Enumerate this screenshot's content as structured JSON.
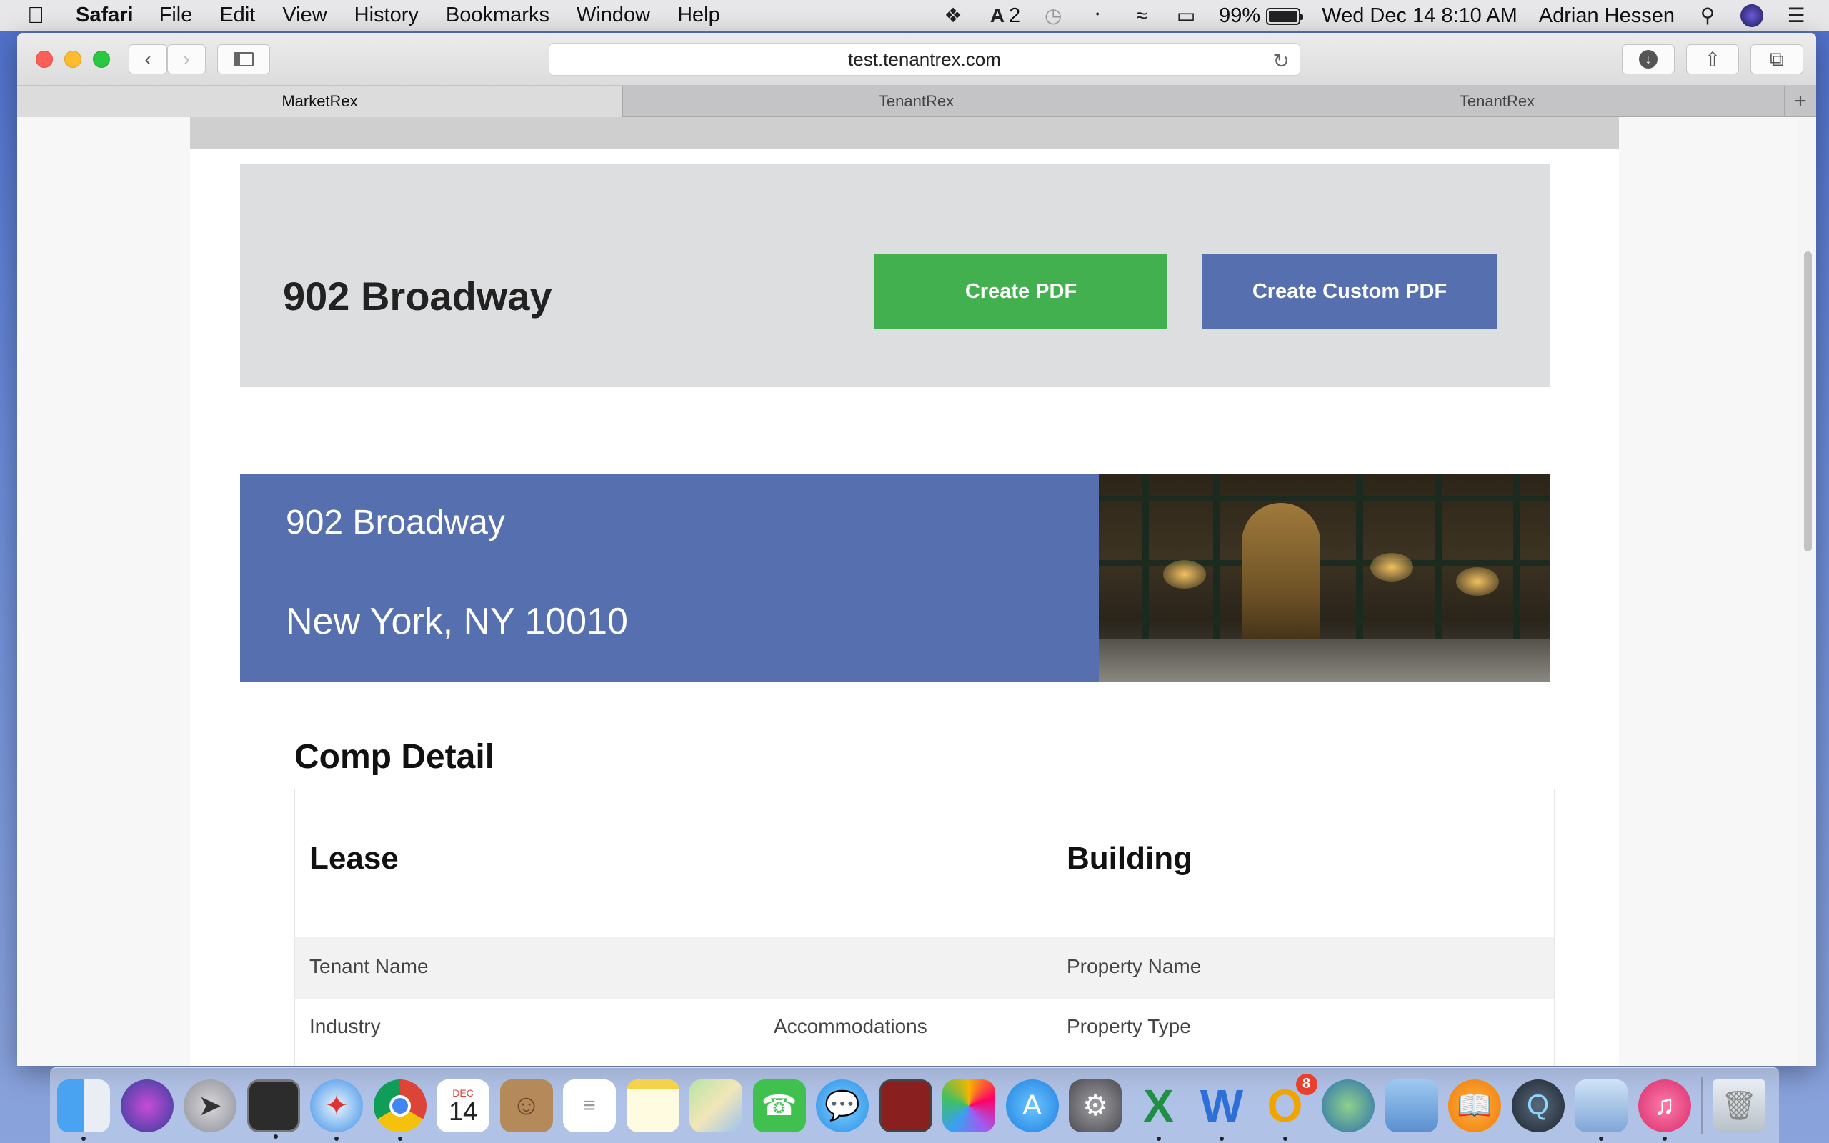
{
  "menubar": {
    "app_name": "Safari",
    "menus": [
      "File",
      "Edit",
      "View",
      "History",
      "Bookmarks",
      "Window",
      "Help"
    ],
    "adobe_count": "2",
    "battery": "99%",
    "battery_level": 0.99,
    "clock": "Wed Dec 14  8:10 AM",
    "user": "Adrian Hessen"
  },
  "browser": {
    "url": "test.tenantrex.com",
    "tabs": [
      {
        "label": "MarketRex",
        "active": true
      },
      {
        "label": "TenantRex",
        "active": false
      },
      {
        "label": "TenantRex",
        "active": false
      }
    ]
  },
  "header": {
    "title": "902 Broadway",
    "create_pdf_label": "Create PDF",
    "create_custom_pdf_label": "Create Custom PDF"
  },
  "address": {
    "line1": "902 Broadway",
    "line2": "New York, NY 10010"
  },
  "comp_detail": {
    "title": "Comp Detail",
    "lease_heading": "Lease",
    "building_heading": "Building",
    "tenant_name_label": "Tenant Name",
    "property_name_label": "Property Name",
    "industry_label": "Industry",
    "accommodations_label": "Accommodations",
    "property_type_label": "Property Type"
  },
  "dock": {
    "calendar_month": "DEC",
    "calendar_day": "14",
    "outlook_badge": "8",
    "apps": [
      "finder",
      "siri",
      "launchpad",
      "photo-booth",
      "safari",
      "chrome",
      "calendar",
      "contacts",
      "reminders",
      "notes",
      "maps",
      "facetime",
      "messages",
      "photo-booth-2",
      "photos",
      "app-store",
      "system-preferences",
      "excel",
      "word",
      "outlook",
      "network",
      "remote-desktop",
      "ibooks",
      "quicktime",
      "preview",
      "itunes",
      "trash"
    ]
  },
  "colors": {
    "create_pdf_green": "#43b04f",
    "brand_blue": "#566fae",
    "header_gray": "#dddee0"
  }
}
